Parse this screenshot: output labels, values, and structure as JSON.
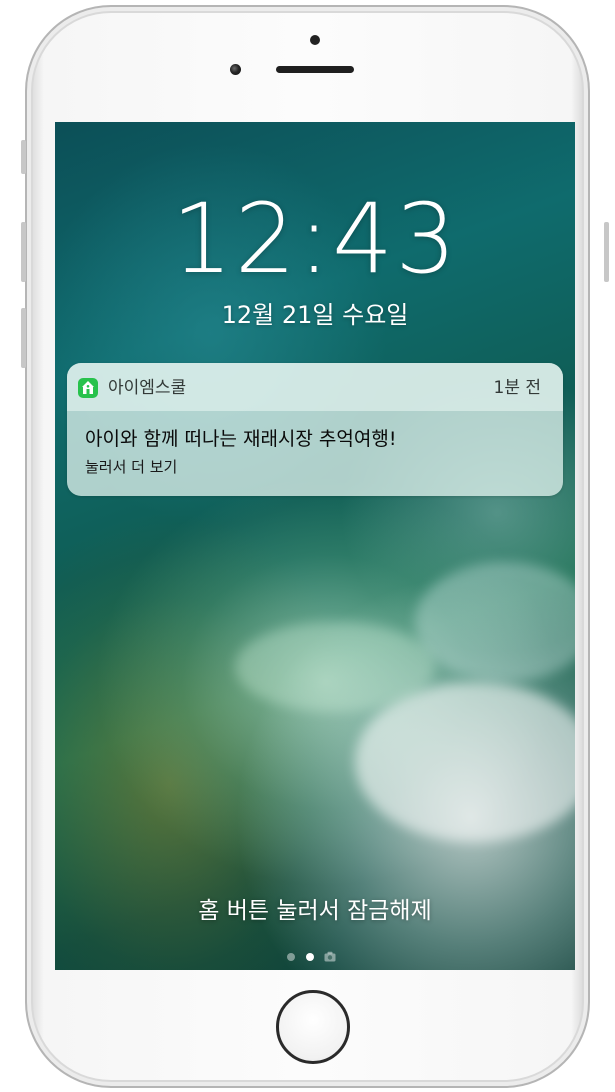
{
  "lock_screen": {
    "time": "12:43",
    "date": "12월 21일 수요일",
    "unlock_hint": "홈 버튼 눌러서 잠금해제"
  },
  "notification": {
    "app_name": "아이엠스쿨",
    "timestamp": "1분 전",
    "title": "아이와 함께 떠나는 재래시장 추억여행!",
    "subtitle": "눌러서 더 보기",
    "app_icon": "school-house-icon",
    "app_icon_color": "#27c24c"
  },
  "page_indicator": {
    "pages": 3,
    "active_index": 1
  },
  "device": {
    "model_color": "silver-white"
  }
}
